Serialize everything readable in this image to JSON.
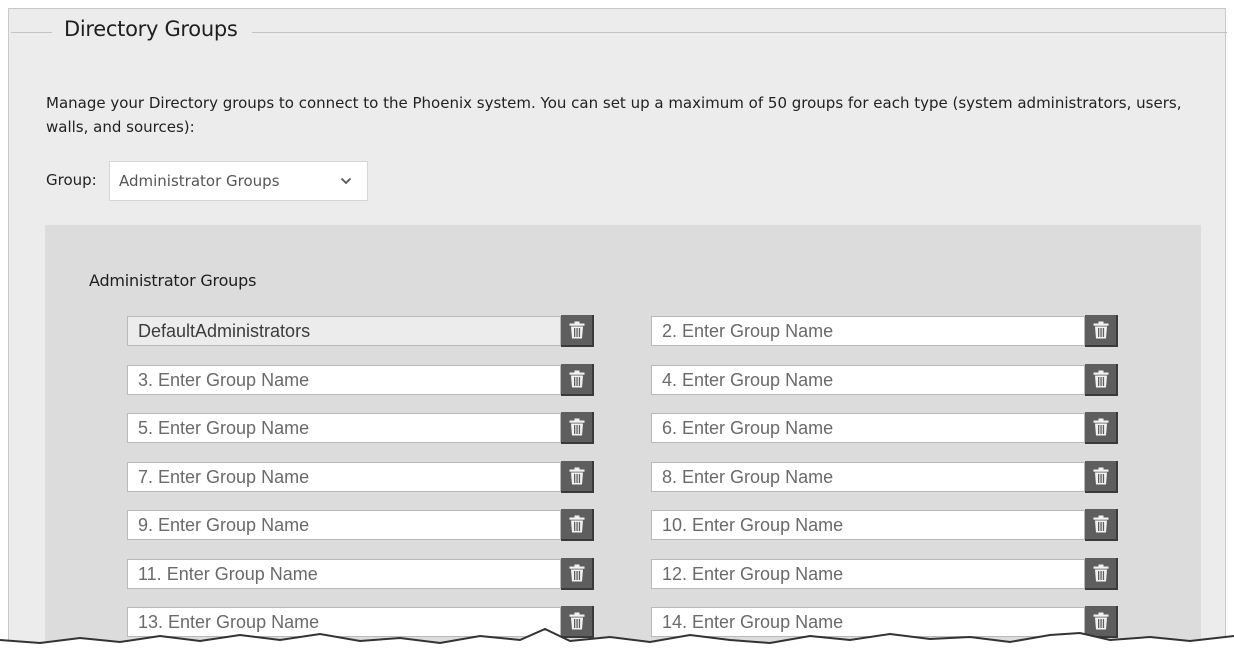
{
  "section": {
    "title": "Directory Groups",
    "description": "Manage your Directory groups to connect to the Phoenix system. You can set up a maximum of 50 groups for each type (system administrators, users, walls, and sources):"
  },
  "group_selector": {
    "label": "Group:",
    "selected": "Administrator Groups"
  },
  "panel": {
    "title": "Administrator Groups",
    "fields": [
      {
        "value": "DefaultAdministrators",
        "placeholder": ""
      },
      {
        "value": "",
        "placeholder": "2. Enter Group Name"
      },
      {
        "value": "",
        "placeholder": "3. Enter Group Name"
      },
      {
        "value": "",
        "placeholder": "4. Enter Group Name"
      },
      {
        "value": "",
        "placeholder": "5. Enter Group Name"
      },
      {
        "value": "",
        "placeholder": "6. Enter Group Name"
      },
      {
        "value": "",
        "placeholder": "7. Enter Group Name"
      },
      {
        "value": "",
        "placeholder": "8. Enter Group Name"
      },
      {
        "value": "",
        "placeholder": "9. Enter Group Name"
      },
      {
        "value": "",
        "placeholder": "10. Enter Group Name"
      },
      {
        "value": "",
        "placeholder": "11. Enter Group Name"
      },
      {
        "value": "",
        "placeholder": "12. Enter Group Name"
      },
      {
        "value": "",
        "placeholder": "13. Enter Group Name"
      },
      {
        "value": "",
        "placeholder": "14. Enter Group Name"
      }
    ]
  },
  "icons": {
    "delete": "trash-icon",
    "dropdown": "chevron-down-icon"
  },
  "colors": {
    "background": "#ececec",
    "panel": "#dcdcdc",
    "trash_button": "#5e5e5e"
  }
}
